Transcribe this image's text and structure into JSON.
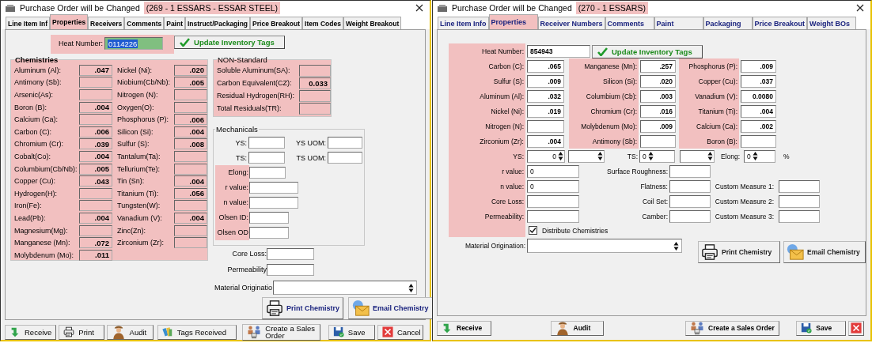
{
  "left_window": {
    "title": "Purchase Order will be Changed",
    "title_note": {
      "text": "(269 - 1 ESSARS - ESSAR STEEL)",
      "highlighted": true
    },
    "tabs": [
      {
        "label": "Line Item Inf",
        "selected": false
      },
      {
        "label": "Properties",
        "selected": true
      },
      {
        "label": "Receivers",
        "selected": false
      },
      {
        "label": "Comments",
        "selected": false
      },
      {
        "label": "Paint",
        "selected": false
      },
      {
        "label": "Instruct/Packaging",
        "selected": false
      },
      {
        "label": "Price Breakout",
        "selected": false
      },
      {
        "label": "Item Codes",
        "selected": false
      },
      {
        "label": "Weight Breakout",
        "selected": false
      }
    ],
    "heat_number": {
      "label": "Heat Number:",
      "value": "0114226",
      "highlighted": true
    },
    "update_button": "Update Inventory Tags",
    "chemistries": {
      "title": "Chemistries",
      "highlighted": true,
      "columns": [
        [
          {
            "label": "Aluminum (Al):",
            "value": ".047"
          },
          {
            "label": "Antimony (Sb):"
          },
          {
            "label": "Arsenic(As):"
          },
          {
            "label": "Boron (B):",
            "value": ".004"
          },
          {
            "label": "Calcium (Ca):"
          },
          {
            "label": "Carbon (C):",
            "value": ".006"
          },
          {
            "label": "Chromium (Cr):",
            "value": ".039"
          },
          {
            "label": "Cobalt(Co):",
            "value": ".004"
          },
          {
            "label": "Columbium(Cb/Nb):",
            "value": ".005"
          },
          {
            "label": "Copper (Cu):",
            "value": ".043"
          },
          {
            "label": "Hydrogen(H):"
          },
          {
            "label": "Iron(Fe):"
          },
          {
            "label": "Lead(Pb):",
            "value": ".004"
          },
          {
            "label": "Magnesium(Mg):"
          },
          {
            "label": "Manganese (Mn):",
            "value": ".072"
          },
          {
            "label": "Molybdenum (Mo):",
            "value": ".011"
          }
        ],
        [
          {
            "label": "Nickel (Ni):",
            "value": ".020"
          },
          {
            "label": "Niobium(Cb/Nb):",
            "value": ".005"
          },
          {
            "label": "Nitrogen (N):"
          },
          {
            "label": "Oxygen(O):"
          },
          {
            "label": "Phosphorus (P):",
            "value": ".006"
          },
          {
            "label": "Silicon (Si):",
            "value": ".004"
          },
          {
            "label": "Sulfur (S):",
            "value": ".008"
          },
          {
            "label": "Tantalum(Ta):"
          },
          {
            "label": "Tellurium(Te):"
          },
          {
            "label": "Tin (Sn):",
            "value": ".004"
          },
          {
            "label": "Titanium (Ti):",
            "value": ".056"
          },
          {
            "label": "Tungsten(W):"
          },
          {
            "label": "Vanadium (V):",
            "value": ".004"
          },
          {
            "label": "Zinc(Zn):"
          },
          {
            "label": "Zirconium (Zr):"
          }
        ]
      ]
    },
    "non_standard": {
      "title": "NON-Standard",
      "highlighted": true,
      "fields": [
        {
          "label": "Soluble Aluminum(SA):"
        },
        {
          "label": "Carbon Equivalent(CZ):",
          "value": "0.033"
        },
        {
          "label": "Residual Hydrogen(RH):"
        },
        {
          "label": "Total Residuals(TR):"
        }
      ]
    },
    "mechanicals": {
      "title": "Mechanicals",
      "top_rows": [
        {
          "label": "YS:",
          "uom_label": "YS UOM:"
        },
        {
          "label": "TS:",
          "uom_label": "TS UOM:"
        }
      ],
      "highlighted": true,
      "fields": [
        {
          "label": "Elong:"
        },
        {
          "label": "r value:"
        },
        {
          "label": "n value:"
        },
        {
          "label": "Olsen ID:"
        },
        {
          "label": "Olsen OD"
        }
      ]
    },
    "extra_fields": [
      {
        "label": "Core Loss:"
      },
      {
        "label": "Permeability"
      }
    ],
    "material_origination": {
      "label": "Material Originatio"
    },
    "chemistry_buttons": [
      {
        "kind": "print",
        "label": "Print Chemistry"
      },
      {
        "kind": "email",
        "label": "Email Chemistry"
      }
    ],
    "footer_buttons": [
      {
        "kind": "receive",
        "label": "Receive"
      },
      {
        "kind": "print",
        "label": "Print"
      },
      {
        "kind": "audit",
        "label": "Audit"
      },
      {
        "kind": "tags",
        "label": "Tags Received"
      },
      {
        "kind": "sales",
        "label": "Create a Sales Order"
      },
      {
        "kind": "save",
        "label": "Save"
      },
      {
        "kind": "cancel",
        "label": "Cancel"
      }
    ]
  },
  "right_window": {
    "title": "Purchase Order will be Changed",
    "title_note": {
      "text": "(270 - 1 ESSARS)",
      "highlighted": true
    },
    "tabs": [
      {
        "label": "Line Item Info",
        "selected": false
      },
      {
        "label": "Properties",
        "selected": true
      },
      {
        "label": "Receiver Numbers",
        "selected": false
      },
      {
        "label": "Comments",
        "selected": false
      },
      {
        "label": "Paint",
        "selected": false
      },
      {
        "label": "Packaging",
        "selected": false
      },
      {
        "label": "Price Breakout",
        "selected": false
      },
      {
        "label": "Weight BOs",
        "selected": false
      }
    ],
    "heat_number": {
      "label": "Heat Number:",
      "value": "854943"
    },
    "update_button": "Update Inventory Tags",
    "chemistry_columns": [
      {
        "highlighted": true,
        "fields": [
          {
            "label": "Carbon (C):",
            "value": ".065"
          },
          {
            "label": "Sulfur (S):",
            "value": ".009"
          },
          {
            "label": "Aluminum (Al):",
            "value": ".032"
          },
          {
            "label": "Nickel (Ni):",
            "value": ".019"
          },
          {
            "label": "Nitrogen (N):"
          },
          {
            "label": "Zirconium (Zr):",
            "value": ".004"
          }
        ]
      },
      {
        "highlighted": true,
        "fields": [
          {
            "label": "Manganese (Mn):",
            "value": ".257"
          },
          {
            "label": "Silicon (Si):",
            "value": ".020"
          },
          {
            "label": "Columbium (Cb):",
            "value": ".003"
          },
          {
            "label": "Chromium (Cr):",
            "value": ".016"
          },
          {
            "label": "Molybdenum (Mo):",
            "value": ".009"
          },
          {
            "label": "Antimony (Sb):"
          }
        ]
      },
      {
        "highlighted": true,
        "fields": [
          {
            "label": "Phosphorus (P):",
            "value": ".009"
          },
          {
            "label": "Copper (Cu):",
            "value": ".037"
          },
          {
            "label": "Vanadium (V):",
            "value": "0.0080"
          },
          {
            "label": "Titanium (Ti):",
            "value": ".004"
          },
          {
            "label": "Calcium (Ca):",
            "value": ".002"
          },
          {
            "label": "Boron (B):"
          }
        ]
      }
    ],
    "strength": [
      {
        "label": "YS:",
        "value": "0"
      },
      {
        "label": "TS:",
        "value": "0"
      }
    ],
    "elong": {
      "label": "Elong:",
      "value": "0",
      "unit": "%"
    },
    "measure_rows": [
      {
        "left": {
          "label": "r value:",
          "value": "0"
        },
        "middle": {
          "label": "Surface Roughness:"
        }
      },
      {
        "left": {
          "label": "n value:",
          "value": "0"
        },
        "middle": {
          "label": "Flatness:"
        },
        "right": {
          "label": "Custom Measure 1:"
        }
      },
      {
        "left": {
          "label": "Core Loss:"
        },
        "middle": {
          "label": "Coil Set:"
        },
        "right": {
          "label": "Custom Measure 2:"
        }
      },
      {
        "left": {
          "label": "Permeability:"
        },
        "middle": {
          "label": "Camber:"
        },
        "right": {
          "label": "Custom Measure 3:"
        }
      }
    ],
    "distribute": {
      "label": "Distribute Chemistries",
      "checked": true
    },
    "material_origination": {
      "label": "Material Origination:"
    },
    "chemistry_buttons": [
      {
        "kind": "print",
        "label": "Print Chemistry"
      },
      {
        "kind": "email",
        "label": "Email Chemistry"
      }
    ],
    "footer_buttons": [
      {
        "kind": "receive",
        "label": "Receive"
      },
      {
        "kind": "audit",
        "label": "Audit"
      },
      {
        "kind": "sales",
        "label": "Create a Sales Order"
      },
      {
        "kind": "save",
        "label": "Save"
      },
      {
        "kind": "cancel"
      }
    ]
  }
}
